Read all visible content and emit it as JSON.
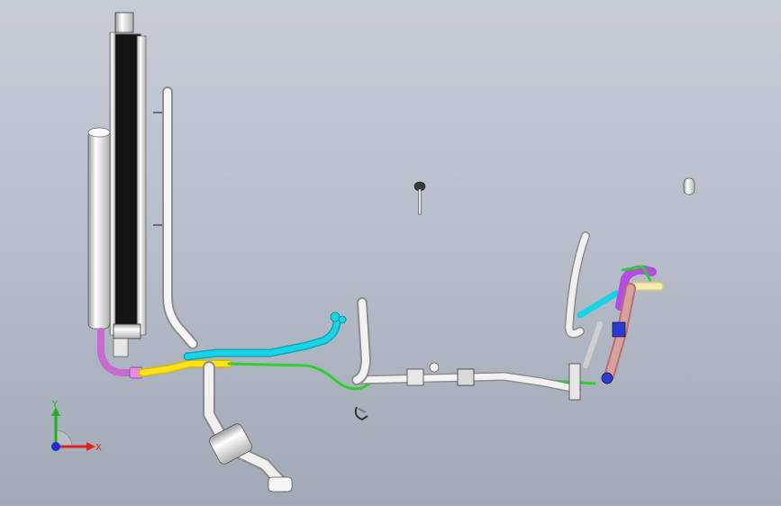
{
  "app": {
    "type": "cad-3d-viewport",
    "document_title": "",
    "background_gradient": [
      "#c7ccd7",
      "#a2a9b6"
    ]
  },
  "scene": {
    "parts": [
      {
        "name": "radiator-core",
        "color": "#1c1c1c"
      },
      {
        "name": "radiator-side-tank",
        "color": "#ececec"
      },
      {
        "name": "cylindrical-reservoir",
        "color": "#f0f0f0"
      },
      {
        "name": "vertical-pipe",
        "color": "#f2f2f2"
      },
      {
        "name": "cyan-hose",
        "color": "#19d4e6"
      },
      {
        "name": "yellow-hose",
        "color": "#ffe21a"
      },
      {
        "name": "green-line",
        "color": "#2fcf2f"
      },
      {
        "name": "pink-fitting",
        "color": "#e58be6"
      },
      {
        "name": "main-horizontal-pipe",
        "color": "#f0f0f0"
      },
      {
        "name": "lower-elbow-assembly",
        "color": "#e8e8e8"
      },
      {
        "name": "right-manifold",
        "color": "#d9a0a0"
      },
      {
        "name": "blue-coupler",
        "color": "#2a3ad4"
      },
      {
        "name": "purple-elbow",
        "color": "#b34ee0"
      },
      {
        "name": "cream-pipe",
        "color": "#f6ecb0"
      },
      {
        "name": "floating-bolt",
        "color": "#e0e0e0"
      },
      {
        "name": "floating-cap",
        "color": "#f0f0f0"
      },
      {
        "name": "hose-clip",
        "color": "#e0e0e0"
      }
    ]
  },
  "triad": {
    "x_label": "X",
    "y_label": "Y",
    "x_color": "#e02020",
    "y_color": "#20b020",
    "z_color": "#2030d0"
  }
}
